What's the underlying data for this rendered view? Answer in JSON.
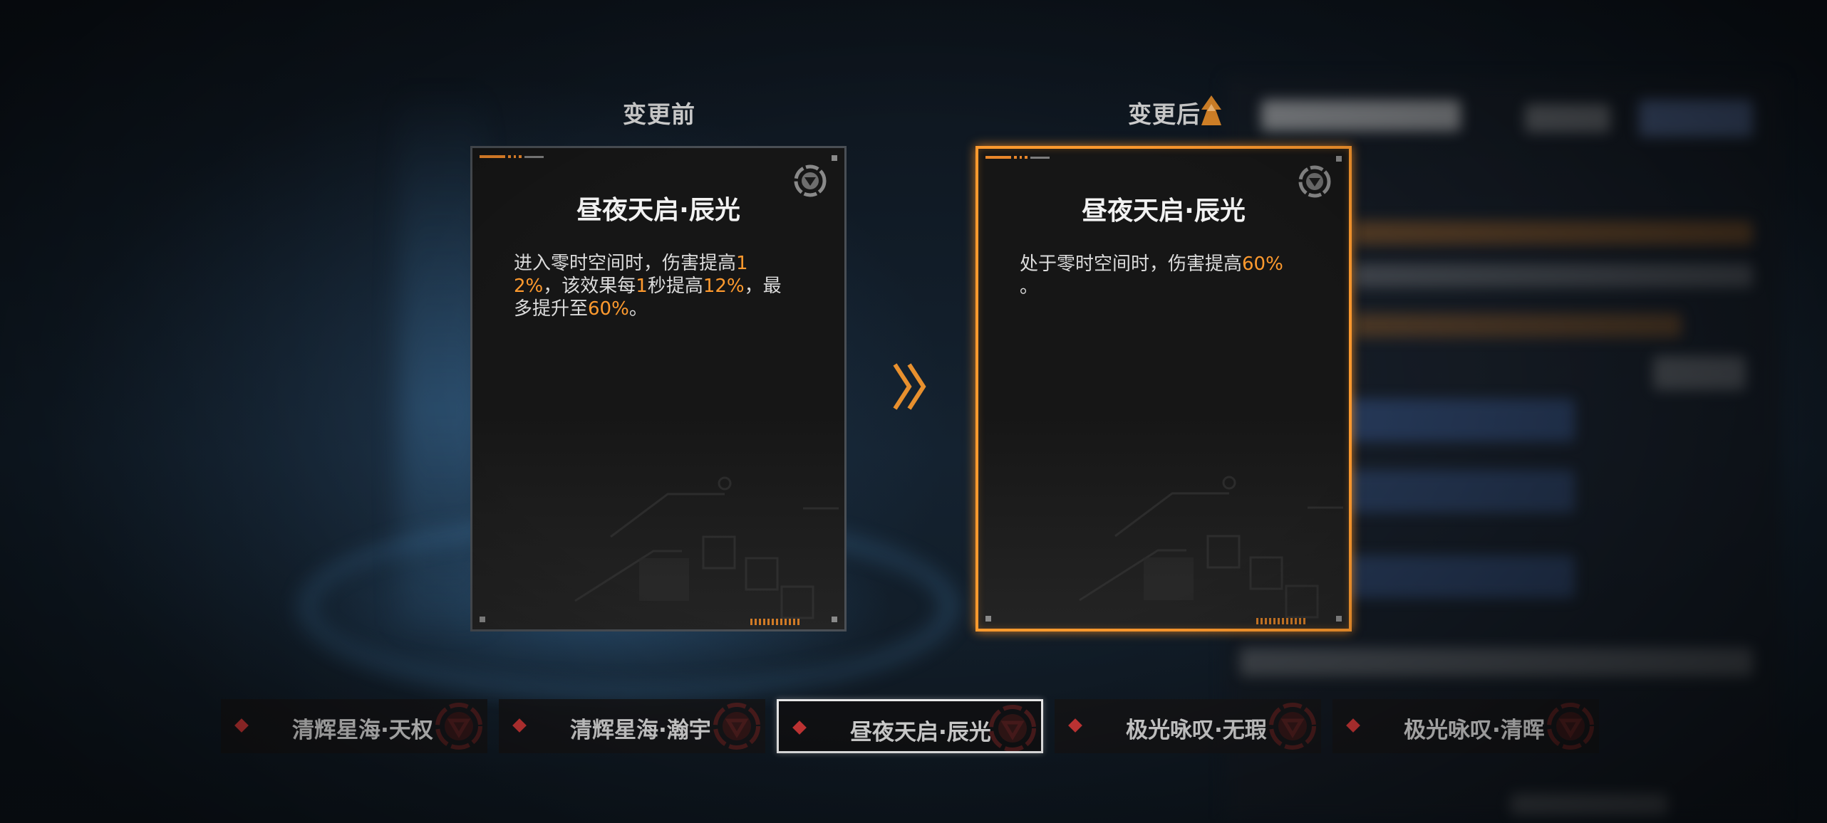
{
  "header": {
    "before_title": "变更前",
    "after_title": "变更后"
  },
  "cards": {
    "before": {
      "name": "昼夜天启·辰光",
      "desc_parts": [
        "进入零时空间时，伤害提高",
        "12%",
        "，该效果每",
        "1",
        "秒提高",
        "12%",
        "，最多提升至",
        "60%",
        "。"
      ]
    },
    "after": {
      "name": "昼夜天启·辰光",
      "desc_parts": [
        "处于零时空间时，伤害提高",
        "60%",
        "。"
      ]
    }
  },
  "tabs": [
    {
      "label": "清辉星海·天权",
      "active": false
    },
    {
      "label": "清辉星海·瀚宇",
      "active": false
    },
    {
      "label": "昼夜天启·辰光",
      "active": true
    },
    {
      "label": "极光咏叹·无瑕",
      "active": false
    },
    {
      "label": "极光咏叹·清晖",
      "active": false
    }
  ],
  "icons": {
    "card_emblem": "triangle-gear-emblem-icon",
    "arrow": "double-chevron-right-icon",
    "upgrade": "up-arrow-badge-icon",
    "tab_marker": "red-diamond-icon"
  },
  "colors": {
    "accent": "#ff9a2e",
    "selected_border": "#ffffff",
    "marker": "#d83a3a"
  }
}
